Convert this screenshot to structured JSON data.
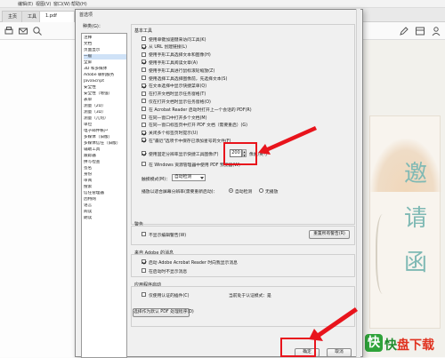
{
  "app": {
    "menu": [
      "编辑(E)",
      "视图(V)",
      "窗口(W)",
      "帮助(H)"
    ],
    "tabs": [
      "主页",
      "工具",
      "1.pdf"
    ],
    "toolbar_icons": [
      "print-icon",
      "mail-icon",
      "search-icon",
      "pen-icon",
      "thumbnail-icon",
      "account-icon"
    ]
  },
  "dialog": {
    "title": "首选项",
    "categories_label": "种类(G)：",
    "categories": [
      "注释",
      "文档",
      "页面显示",
      "一般",
      "全屏",
      "3D 和多媒体",
      "Adobe 联机服务",
      "JavaScript",
      "安全性",
      "安全性（增强）",
      "表单",
      "测量（2D）",
      "测量（3D）",
      "测量（几何）",
      "单位",
      "电子邮件帐户",
      "多媒体（旧版）",
      "多媒体信任（旧版）",
      "辅助工具",
      "跟踪器",
      "拼写检查",
      "签名",
      "身份",
      "审阅",
      "搜索",
      "信任管理器",
      "因特网",
      "语言",
      "阅读",
      "朗读"
    ],
    "selected_category": 3,
    "basic_tools": {
      "title": "基本工具",
      "options": [
        {
          "label": "使用单键加速键来访问工具(K)",
          "checked": false
        },
        {
          "label": "从 URL 创建链接(L)",
          "checked": true
        },
        {
          "label": "使用手形工具选择文本和图像(H)",
          "checked": false
        },
        {
          "label": "使用手形工具阅读文章(A)",
          "checked": true
        },
        {
          "label": "使用手形工具进行鼠标滚轮缩放(Z)",
          "checked": false
        },
        {
          "label": "使用选择工具选择图像前，先选择文本(S)",
          "checked": false
        },
        {
          "label": "在文本选择中显示快捷菜单(Q)",
          "checked": true
        },
        {
          "label": "在打开文档时显示任务窗格(T)",
          "checked": false
        },
        {
          "label": "仅在打开文档时显示任务窗格(O)",
          "checked": false
        },
        {
          "label": "在 Acrobat Reader 启动时打开上一个会话的 PDF(R)",
          "checked": false
        },
        {
          "label": "在同一窗口中打开多个文档(M)",
          "checked": false
        },
        {
          "label": "在同一窗口标签页中打开 PDF 文档（需要重启）(G)",
          "checked": false
        },
        {
          "label": "关闭多个标签页时提示(U)",
          "checked": true
        },
        {
          "label": "在\"最近\"选项卡中保存已添加星号的文件(F)",
          "checked": true
        }
      ],
      "icon_size_label": "使用固定分辨率显示快捷工具图像(F)",
      "icon_size_checked": true,
      "icon_size_value": "200",
      "icon_size_unit": "像素/英寸",
      "windows_option": "在 Windows 资源管理器中使用 PDF 预览器(W)",
      "theme_label": "触摸模式(M)：",
      "theme_value": "自动检测",
      "toolbar_label": "播放以适合屏幕分辨率(需要重新启动)：",
      "radio_auto": "自动检测",
      "radio_off": "无播放"
    },
    "warnings": {
      "title": "警告",
      "option": "不显示编辑警告(W)",
      "button": "重置所有警告(R)"
    },
    "messages": {
      "title": "来自 Adobe 的消息",
      "opt1": "启动 Adobe Acrobat Reader 时向我显示消息",
      "opt2": "在启动时不显示消息"
    },
    "startup": {
      "title": "应用程序启动",
      "opt": "仅使用认证的插件(C)",
      "status_label": "当前处于认证模式：",
      "status_value": "是",
      "button": "选择作为默认 PDF 处理程序(D)"
    },
    "ok": "确定",
    "cancel": "取消"
  },
  "card": {
    "chars": "邀请函"
  },
  "watermark": {
    "logo": "快",
    "text_a": "快",
    "text_b": "盘下载"
  },
  "colors": {
    "highlight": "#e8141c",
    "accent_teal": "#7fb9b4",
    "brand_green": "#2fa33a"
  }
}
